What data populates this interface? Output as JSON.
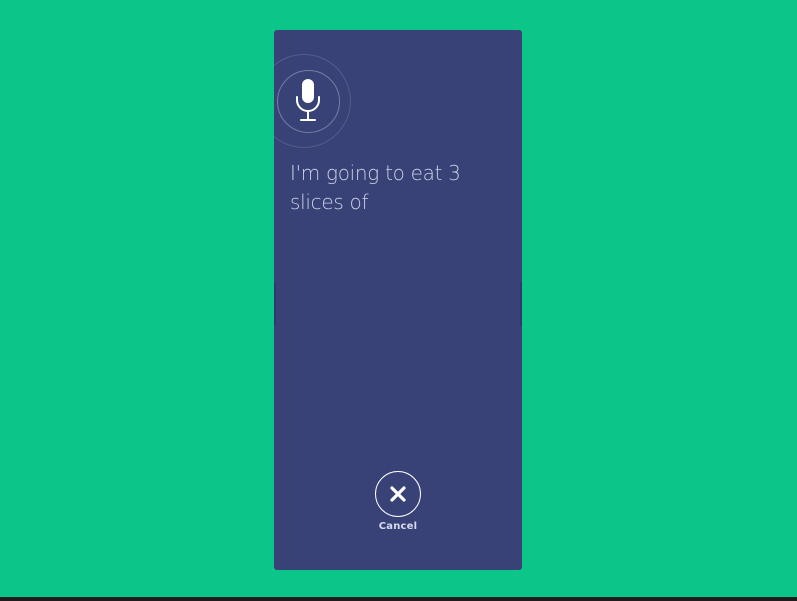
{
  "voice_input": {
    "transcript": "I'm going to eat 3 slices of",
    "cancel_label": "Cancel"
  },
  "icons": {
    "microphone": "microphone-icon",
    "close": "close-icon"
  },
  "colors": {
    "background": "#0bc589",
    "panel": "#384277",
    "text": "#e2e6f5"
  }
}
